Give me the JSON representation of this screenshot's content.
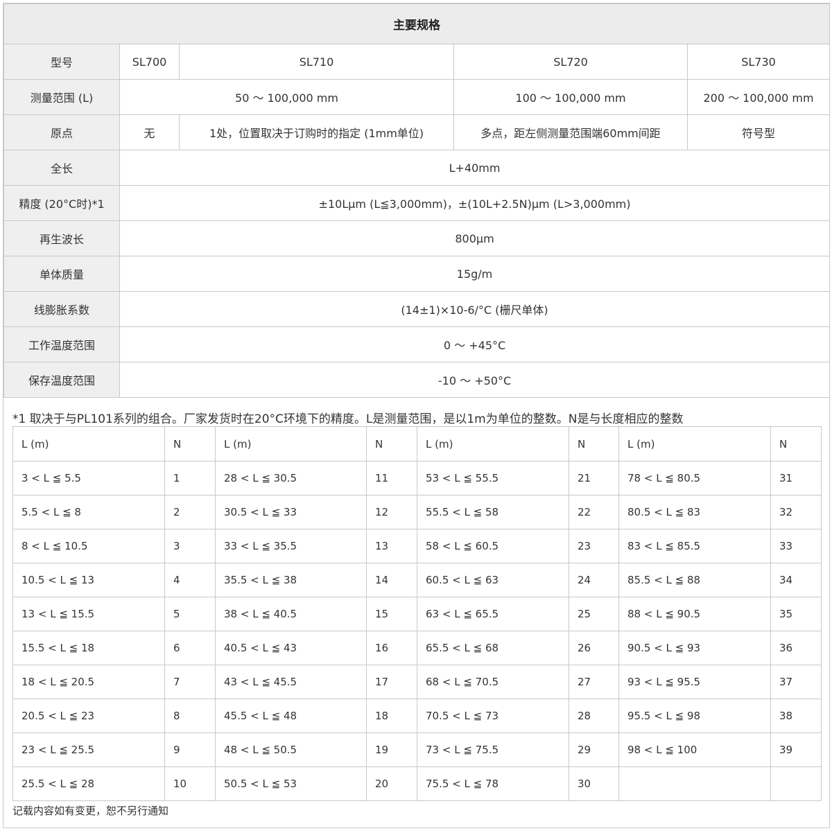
{
  "spec": {
    "title": "主要规格",
    "rows": {
      "model": {
        "label": "型号",
        "sl700": "SL700",
        "sl710": "SL710",
        "sl720": "SL720",
        "sl730": "SL730"
      },
      "range": {
        "label": "测量范围 (L)",
        "v1": "50 ～ 100,000 mm",
        "v2": "100 ～ 100,000 mm",
        "v3": "200 ～ 100,000 mm"
      },
      "origin": {
        "label": "原点",
        "sl700": "无",
        "sl710": "1处，位置取决于订购时的指定 (1mm单位)",
        "sl720": "多点，距左侧测量范围端60mm间距",
        "sl730": "符号型"
      },
      "total_length": {
        "label": "全长",
        "value": "L+40mm"
      },
      "accuracy": {
        "label": "精度 (20°C时)*1",
        "value": "±10Lμm (L≦3,000mm)，±(10L+2.5N)μm (L>3,000mm)"
      },
      "wavelength": {
        "label": "再生波长",
        "value": "800μm"
      },
      "mass": {
        "label": "单体质量",
        "value": "15g/m"
      },
      "expansion": {
        "label": "线膨胀系数",
        "value": "(14±1)×10-6/°C (栅尺单体)"
      },
      "op_temp": {
        "label": "工作温度范围",
        "value": "0 ～ +45°C"
      },
      "storage_temp": {
        "label": "保存温度范围",
        "value": "-10 ～ +50°C"
      }
    }
  },
  "note": "*1 取决于与PL101系列的组合。厂家发货时在20°C环境下的精度。L是测量范围，是以1m为单位的整数。N是与长度相应的整数",
  "n_table": {
    "headers": [
      "L (m)",
      "N",
      "L (m)",
      "N",
      "L (m)",
      "N",
      "L (m)",
      "N"
    ],
    "rows": [
      [
        "3 < L ≦ 5.5",
        "1",
        "28 < L ≦ 30.5",
        "11",
        "53 < L ≦ 55.5",
        "21",
        "78 < L ≦ 80.5",
        "31"
      ],
      [
        "5.5 < L ≦ 8",
        "2",
        "30.5 < L ≦ 33",
        "12",
        "55.5 < L ≦ 58",
        "22",
        "80.5 < L ≦ 83",
        "32"
      ],
      [
        "8 < L ≦ 10.5",
        "3",
        "33 < L ≦ 35.5",
        "13",
        "58 < L ≦ 60.5",
        "23",
        "83 < L ≦ 85.5",
        "33"
      ],
      [
        "10.5 < L ≦ 13",
        "4",
        "35.5 < L ≦ 38",
        "14",
        "60.5 < L ≦ 63",
        "24",
        "85.5 < L ≦ 88",
        "34"
      ],
      [
        "13 < L ≦ 15.5",
        "5",
        "38 < L ≦ 40.5",
        "15",
        "63 < L ≦ 65.5",
        "25",
        "88 < L ≦ 90.5",
        "35"
      ],
      [
        "15.5 < L ≦ 18",
        "6",
        "40.5 < L ≦ 43",
        "16",
        "65.5 < L ≦ 68",
        "26",
        "90.5 < L ≦ 93",
        "36"
      ],
      [
        "18 < L ≦ 20.5",
        "7",
        "43 < L ≦ 45.5",
        "17",
        "68 < L ≦ 70.5",
        "27",
        "93 < L ≦ 95.5",
        "37"
      ],
      [
        "20.5 < L ≦ 23",
        "8",
        "45.5 < L ≦ 48",
        "18",
        "70.5 < L ≦ 73",
        "28",
        "95.5 < L ≦ 98",
        "38"
      ],
      [
        "23 < L ≦ 25.5",
        "9",
        "48 < L ≦ 50.5",
        "19",
        "73 < L ≦ 75.5",
        "29",
        "98 < L ≦ 100",
        "39"
      ],
      [
        "25.5 < L ≦ 28",
        "10",
        "50.5 < L ≦ 53",
        "20",
        "75.5 < L ≦ 78",
        "30",
        "",
        ""
      ]
    ]
  },
  "footer": "记载内容如有变更，恕不另行通知"
}
